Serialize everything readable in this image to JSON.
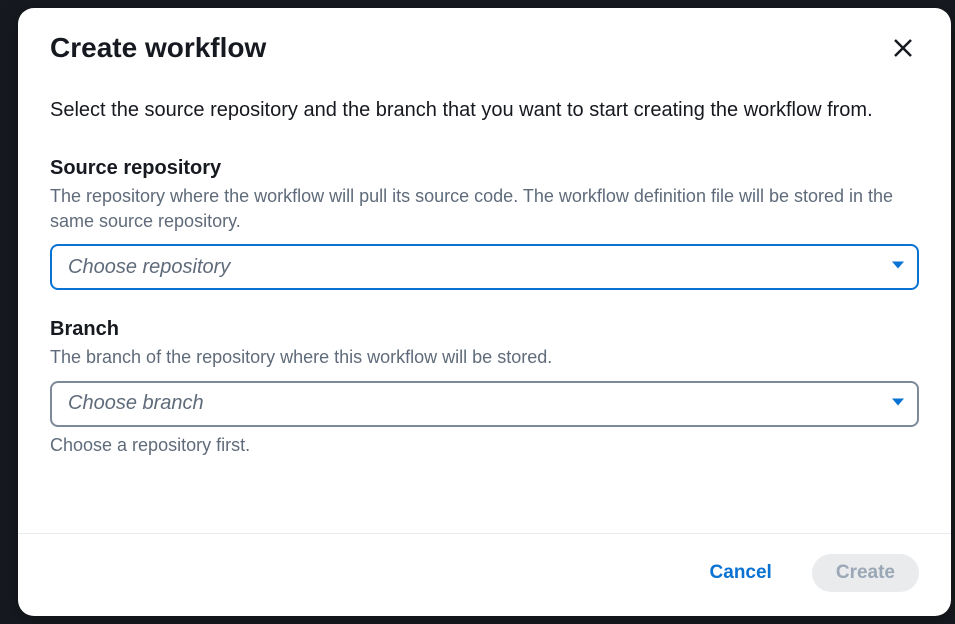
{
  "modal": {
    "title": "Create workflow",
    "intro": "Select the source repository and the branch that you want to start creating the workflow from.",
    "fields": {
      "repository": {
        "label": "Source repository",
        "help": "The repository where the workflow will pull its source code. The workflow definition file will be stored in the same source repository.",
        "placeholder": "Choose repository"
      },
      "branch": {
        "label": "Branch",
        "help": "The branch of the repository where this workflow will be stored.",
        "placeholder": "Choose branch",
        "hint": "Choose a repository first."
      }
    },
    "buttons": {
      "cancel": "Cancel",
      "create": "Create"
    }
  }
}
